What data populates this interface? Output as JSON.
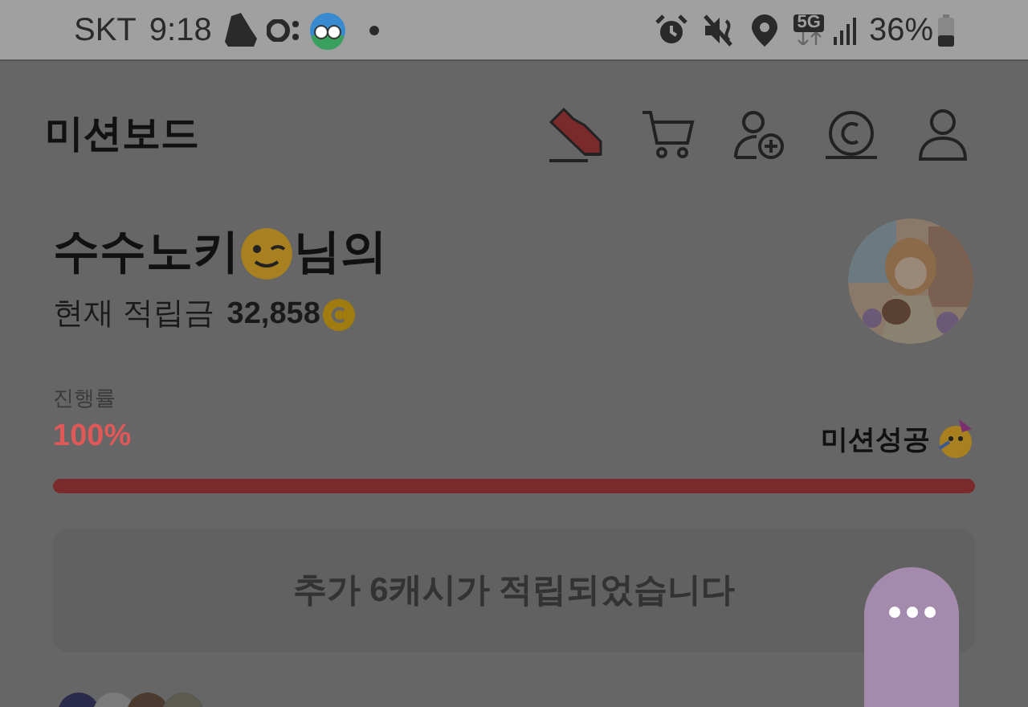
{
  "status_bar": {
    "carrier": "SKT",
    "time": "9:18",
    "network": "5G",
    "battery": "36%"
  },
  "header": {
    "title": "미션보드"
  },
  "profile": {
    "name": "수수노키",
    "suffix": "님의",
    "balance_label": "현재 적립금",
    "balance": "32,858"
  },
  "progress": {
    "label": "진행률",
    "percent": "100%",
    "level": 1,
    "result": "미션성공"
  },
  "notice": "추가 6캐시가 적립되었습니다"
}
